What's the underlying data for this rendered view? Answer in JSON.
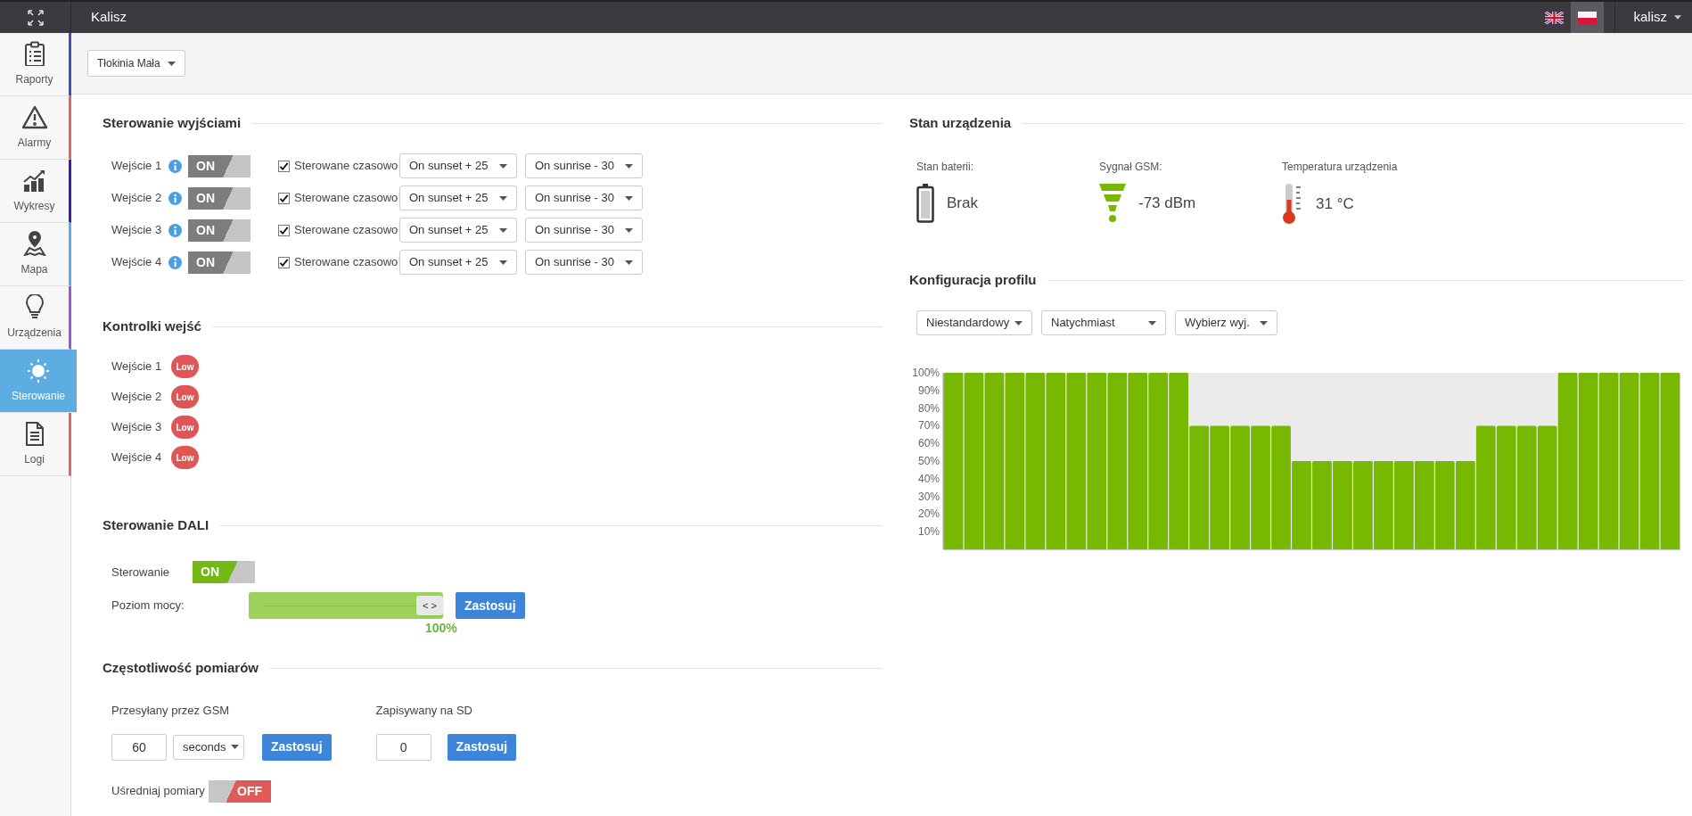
{
  "topbar": {
    "title": "Kalisz",
    "languages": [
      {
        "kind": "en",
        "selected": false
      },
      {
        "kind": "pl",
        "selected": true
      }
    ],
    "user": "kalisz"
  },
  "sidebar": {
    "items": [
      {
        "label": "Raporty",
        "kind": "clipboard",
        "color": "#3f51b5",
        "selected": false
      },
      {
        "label": "Alarmy",
        "kind": "warning",
        "color": "#e06666",
        "selected": false
      },
      {
        "label": "Wykresy",
        "kind": "chart",
        "color": "#3a1fa6",
        "selected": false
      },
      {
        "label": "Mapa",
        "kind": "map",
        "color": "#5dade2",
        "selected": false
      },
      {
        "label": "Urządzenia",
        "kind": "bulb",
        "color": "#9b59d0",
        "selected": false
      },
      {
        "label": "Sterowanie",
        "kind": "dial",
        "color": "#5dade2",
        "selected": true
      },
      {
        "label": "Logi",
        "kind": "document",
        "color": "#e06666",
        "selected": false
      }
    ]
  },
  "location": "Tłokinia Mała",
  "outputs": {
    "title": "Sterowanie wyjściami",
    "rows": [
      {
        "label": "Wejście 1",
        "toggle": "ON",
        "on": true,
        "timed_label": "Sterowane czasowo",
        "checked": true,
        "start": "On sunset + 25",
        "end": "On sunrise - 30"
      },
      {
        "label": "Wejście 2",
        "toggle": "ON",
        "on": true,
        "timed_label": "Sterowane czasowo",
        "checked": true,
        "start": "On sunset + 25",
        "end": "On sunrise - 30"
      },
      {
        "label": "Wejście 3",
        "toggle": "ON",
        "on": true,
        "timed_label": "Sterowane czasowo",
        "checked": true,
        "start": "On sunset + 25",
        "end": "On sunrise - 30"
      },
      {
        "label": "Wejście 4",
        "toggle": "ON",
        "on": true,
        "timed_label": "Sterowane czasowo",
        "checked": true,
        "start": "On sunset + 25",
        "end": "On sunrise - 30"
      }
    ]
  },
  "indicators": {
    "title": "Kontrolki wejść",
    "rows": [
      {
        "label": "Wejście 1",
        "badge": "Low"
      },
      {
        "label": "Wejście 2",
        "badge": "Low"
      },
      {
        "label": "Wejście 3",
        "badge": "Low"
      },
      {
        "label": "Wejście 4",
        "badge": "Low"
      }
    ]
  },
  "dali": {
    "title": "Sterowanie DALI",
    "control_label": "Sterowanie",
    "toggle": "ON",
    "on": true,
    "power_label": "Poziom mocy:",
    "handle": "< >",
    "level": 1,
    "reading": "100%",
    "apply": "Zastosuj"
  },
  "frequency": {
    "title": "Częstotliwość pomiarów",
    "gsm_label": "Przesyłany przez GSM",
    "gsm_value": "60",
    "gsm_unit": "seconds",
    "gsm_apply": "Zastosuj",
    "sd_label": "Zapisywany na SD",
    "sd_value": "0",
    "sd_apply": "Zastosuj",
    "average_label": "Uśredniaj pomiary",
    "average_toggle": "OFF",
    "average_on": false
  },
  "device": {
    "title": "Stan urządzenia",
    "items": [
      {
        "kind": "battery",
        "label": "Stan baterii:",
        "value": "Brak"
      },
      {
        "kind": "signal",
        "label": "Sygnał GSM:",
        "value": "-73 dBm"
      },
      {
        "kind": "temperature",
        "label": "Temperatura urządzenia",
        "value": "31 °C"
      }
    ]
  },
  "profile": {
    "title": "Konfiguracja profilu",
    "dropdowns": [
      "Niestandardowy",
      "Natychmiast",
      "Wybierz wyj."
    ],
    "chart_data": {
      "type": "bar",
      "ylim": [
        0,
        100
      ],
      "yticks": [
        {
          "value": 10,
          "label": "10%"
        },
        {
          "value": 20,
          "label": "20%"
        },
        {
          "value": 30,
          "label": "30%"
        },
        {
          "value": 40,
          "label": "40%"
        },
        {
          "value": 50,
          "label": "50%"
        },
        {
          "value": 60,
          "label": "60%"
        },
        {
          "value": 70,
          "label": "70%"
        },
        {
          "value": 80,
          "label": "80%"
        },
        {
          "value": 90,
          "label": "90%"
        },
        {
          "value": 100,
          "label": "100%"
        }
      ],
      "values": [
        100,
        100,
        100,
        100,
        100,
        100,
        100,
        100,
        100,
        100,
        100,
        100,
        70,
        70,
        70,
        70,
        70,
        50,
        50,
        50,
        50,
        50,
        50,
        50,
        50,
        50,
        70,
        70,
        70,
        70,
        100,
        100,
        100,
        100,
        100,
        100
      ]
    }
  }
}
